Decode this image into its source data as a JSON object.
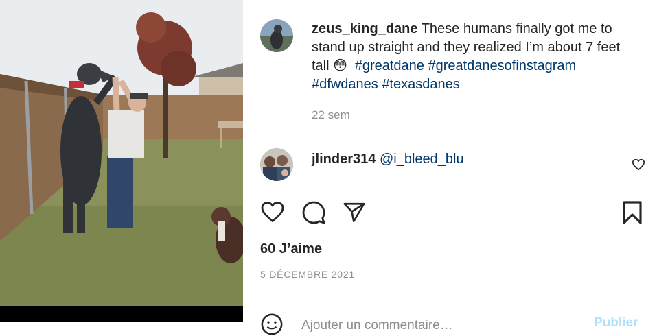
{
  "post": {
    "author": "zeus_king_dane",
    "caption_text": "These humans finally got me to stand up straight and they realized I’m about 7 feet tall",
    "caption_emoji": "😳",
    "hashtags": [
      "#greatdane",
      "#greatdanesofinstagram",
      "#dfwdanes",
      "#texasdanes"
    ],
    "time_ago": "22 sem"
  },
  "comments": [
    {
      "user": "jlinder314",
      "text": "@i_bleed_blu"
    }
  ],
  "actions": {
    "like_icon": "heart-icon",
    "comment_icon": "comment-bubble-icon",
    "share_icon": "paper-plane-icon",
    "save_icon": "bookmark-icon"
  },
  "likes": "60 J’aime",
  "date": "5 DÉCEMBRE 2021",
  "add_comment": {
    "placeholder": "Ajouter un commentaire…",
    "publish_label": "Publier"
  },
  "colors": {
    "link": "#00376b",
    "muted": "#8e8e8e",
    "divider": "#dbdbdb",
    "publish_disabled": "#b2dffc"
  }
}
